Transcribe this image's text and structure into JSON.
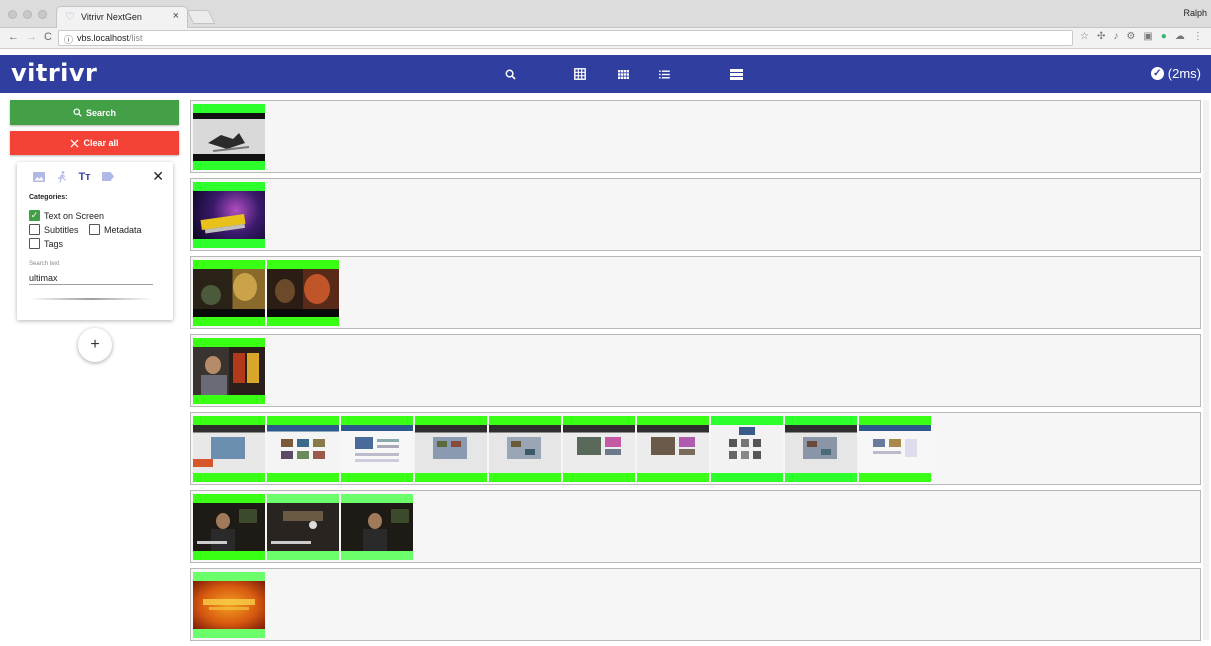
{
  "browser": {
    "tab_title": "Vitrivr NextGen",
    "tab_close": "×",
    "profile_name": "Ralph",
    "url_host": "vbs.localhost",
    "url_path": "/list",
    "info_icon": "ⓘ",
    "back": "←",
    "forward": "→",
    "reload": "C"
  },
  "app": {
    "logo": "vitrivr",
    "status_text": "(2ms)",
    "status_icon": "✓",
    "accent": "#303f9f"
  },
  "sidebar": {
    "search_label": "Search",
    "clear_label": "Clear all",
    "search_color": "#43a047",
    "clear_color": "#f44336",
    "query": {
      "tab_text_glyph": "Tт",
      "close": "✕",
      "categories_label": "Categories:",
      "categories": [
        {
          "label": "Text on Screen",
          "checked": true
        },
        {
          "label": "Subtitles",
          "checked": false
        },
        {
          "label": "Metadata",
          "checked": false
        },
        {
          "label": "Tags",
          "checked": false
        }
      ],
      "field_label": "Search text",
      "field_value": "ultimax"
    },
    "add_label": "+"
  },
  "results": {
    "rows": [
      {
        "thumbnail_count": 1
      },
      {
        "thumbnail_count": 1
      },
      {
        "thumbnail_count": 2
      },
      {
        "thumbnail_count": 1
      },
      {
        "thumbnail_count": 10
      },
      {
        "thumbnail_count": 3
      },
      {
        "thumbnail_count": 1
      }
    ]
  }
}
